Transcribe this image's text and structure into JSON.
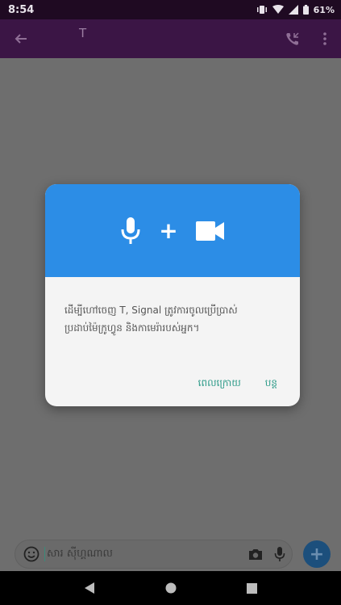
{
  "status_bar": {
    "time": "8:54",
    "battery": "61%"
  },
  "toolbar": {
    "title": "T"
  },
  "composer": {
    "placeholder": "សារ ស៊ីហ្គណាល"
  },
  "send_fab": {
    "label": "+"
  },
  "dialog": {
    "plus": "+",
    "message": "ដើម្បីហៅចេញ T,  Signal ត្រូវការចូលប្រើប្រាស់ប្រដាប់ម៉ៃក្រូហ្វូន និងកាមេរ៉ារបស់អ្នក។",
    "later_button": "ពេលក្រោយ",
    "continue_button": "បន្ត"
  },
  "colors": {
    "toolbar": "#3b1545",
    "dialog_header": "#2c8de6",
    "dialog_button": "#2c9a88"
  }
}
